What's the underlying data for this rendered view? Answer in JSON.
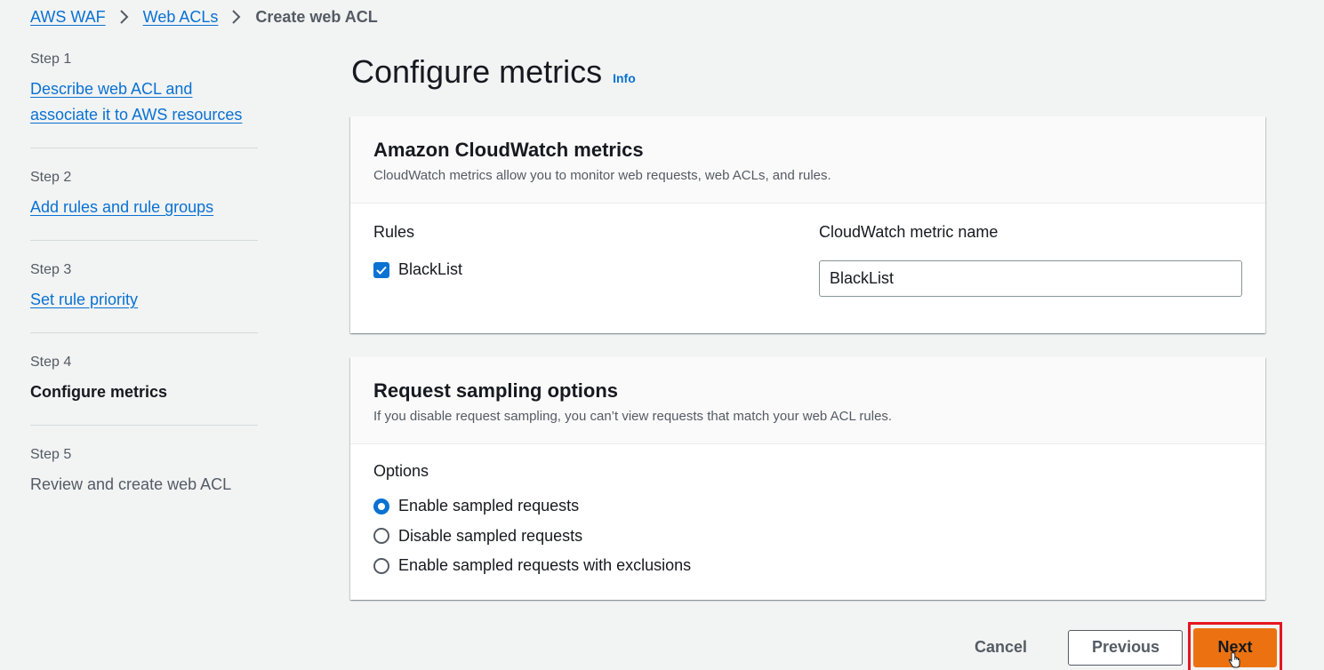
{
  "breadcrumb": {
    "items": [
      "AWS WAF",
      "Web ACLs"
    ],
    "current": "Create web ACL"
  },
  "steps": [
    {
      "num": "Step 1",
      "title": "Describe web ACL and associate it to AWS resources",
      "title_line1": "Describe web ACL and",
      "title_line2": "associate it to AWS resources",
      "state": "link"
    },
    {
      "num": "Step 2",
      "title": "Add rules and rule groups",
      "state": "link"
    },
    {
      "num": "Step 3",
      "title": "Set rule priority",
      "state": "link"
    },
    {
      "num": "Step 4",
      "title": "Configure metrics",
      "state": "active"
    },
    {
      "num": "Step 5",
      "title": "Review and create web ACL",
      "state": "disabled"
    }
  ],
  "page": {
    "title": "Configure metrics",
    "info_link": "Info"
  },
  "cloudwatch": {
    "title": "Amazon CloudWatch metrics",
    "description": "CloudWatch metrics allow you to monitor web requests, web ACLs, and rules.",
    "rules_label": "Rules",
    "metric_label": "CloudWatch metric name",
    "rule_name": "BlackList",
    "rule_checked": true,
    "metric_value": "BlackList"
  },
  "sampling": {
    "title": "Request sampling options",
    "description": "If you disable request sampling, you can’t view requests that match your web ACL rules.",
    "options_label": "Options",
    "options": [
      {
        "label": "Enable sampled requests",
        "checked": true
      },
      {
        "label": "Disable sampled requests",
        "checked": false
      },
      {
        "label": "Enable sampled requests with exclusions",
        "checked": false
      }
    ]
  },
  "footer": {
    "cancel": "Cancel",
    "previous": "Previous",
    "next": "Next"
  },
  "colors": {
    "link": "#0972d3",
    "primary": "#ec7211",
    "highlight": "#e5161f",
    "background": "#f2f3f3"
  }
}
